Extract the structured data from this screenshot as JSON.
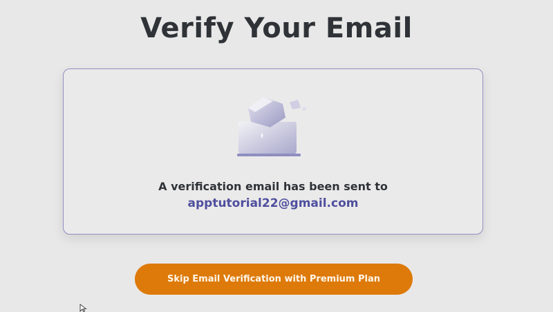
{
  "page": {
    "title": "Verify Your Email"
  },
  "card": {
    "illustration_icon": "laptop-envelope-icon",
    "sent_text": "A verification email has been sent to",
    "email": "apptutorial22@gmail.com"
  },
  "actions": {
    "skip_label": "Skip Email Verification with Premium Plan"
  },
  "colors": {
    "background": "#e9e8e8",
    "title": "#2f3338",
    "card_border": "#8f8fc4",
    "email": "#4e4f9e",
    "button": "#dd7a0a",
    "button_text": "#fff6ea"
  }
}
